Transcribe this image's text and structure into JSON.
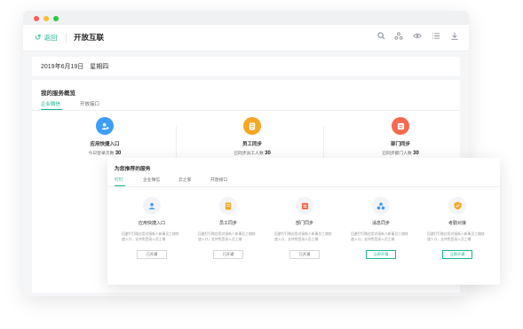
{
  "app": {
    "back_label": "返回",
    "title": "开放互联",
    "toolbar": [
      "search-icon",
      "org-icon",
      "eye-icon",
      "list-icon",
      "download-icon"
    ]
  },
  "date_label": "2019年6月19日　星期四",
  "overview": {
    "title": "我的服务概览",
    "tabs": [
      {
        "label": "企业微信",
        "active": true
      },
      {
        "label": "开放接口",
        "active": false
      }
    ],
    "stats": [
      {
        "name": "应用快捷入口",
        "sub_prefix": "今日登录次数",
        "value": "30",
        "color": "#3c9ef5",
        "icon": "app-icon"
      },
      {
        "name": "员工同步",
        "sub_prefix": "已同步员工人数",
        "value": "30",
        "color": "#f5a623",
        "icon": "doc-icon"
      },
      {
        "name": "部门同步",
        "sub_prefix": "已同步部门人数",
        "value": "30",
        "color": "#f26b4f",
        "icon": "dept-icon"
      }
    ]
  },
  "recommended": {
    "title": "为您推荐的服务",
    "tabs": [
      {
        "label": "钉钉",
        "active": true
      },
      {
        "label": "企业微信",
        "active": false
      },
      {
        "label": "云之家",
        "active": false
      },
      {
        "label": "开放接口",
        "active": false
      }
    ],
    "cards": [
      {
        "name": "应用快捷入口",
        "desc": "回避钉钉微应用对接新人新事员工随快速入口，支持免登录入员工端",
        "button": "已开通",
        "primary": false,
        "icon": "person-icon",
        "color": "#3c9ef5"
      },
      {
        "name": "员工同步",
        "desc": "回避钉钉微应用对接新人新事员工随快速入口，支持免登录入员工端",
        "button": "已开通",
        "primary": false,
        "icon": "doc-icon",
        "color": "#f5a623"
      },
      {
        "name": "部门同步",
        "desc": "回避钉钉微应用对接新人新事员工随快速入口，支持免登录入员工端",
        "button": "已开通",
        "primary": false,
        "icon": "dept-icon",
        "color": "#f26b4f"
      },
      {
        "name": "消息同步",
        "desc": "回避钉钉微应用对接新人新事员工随快速入口，支持免登录入员工端",
        "button": "立即开通",
        "primary": true,
        "icon": "message-icon",
        "color": "#3c9ef5"
      },
      {
        "name": "考勤对接",
        "desc": "回避钉钉微应用对接新人新事员工随快速入口，支持免登录入员工端",
        "button": "立即开通",
        "primary": true,
        "icon": "shield-icon",
        "color": "#f5a623"
      }
    ]
  }
}
